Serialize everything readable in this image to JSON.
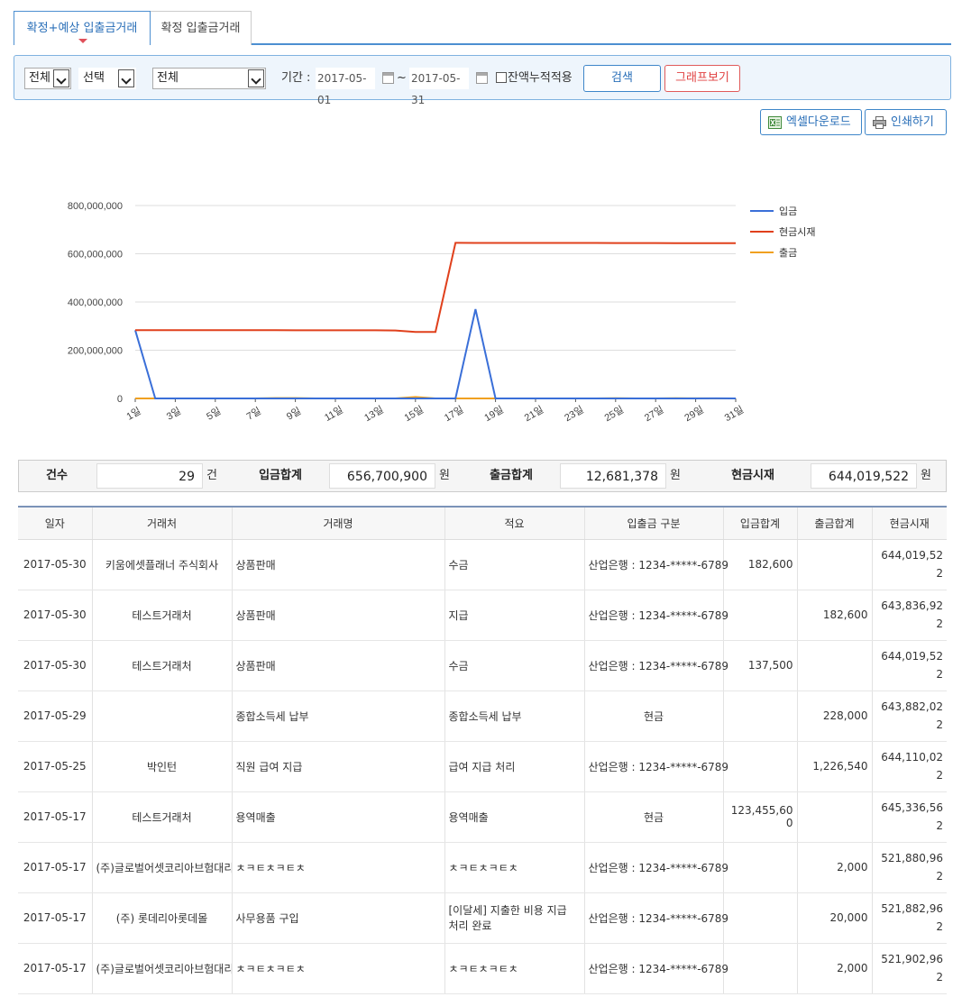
{
  "tabs": [
    {
      "label": "확정+예상 입출금거래",
      "active": true
    },
    {
      "label": "확정 입출금거래",
      "active": false
    }
  ],
  "filters": {
    "select_all": "전체",
    "select_choice": "선택",
    "select_account": "전체",
    "period_label": "기간 :",
    "date_from": "2017-05-01",
    "tilde": "~",
    "date_to": "2017-05-31",
    "checkbox_label": "잔액누적적용",
    "search_label": "검색",
    "graph_label": "그래프보기"
  },
  "tools": {
    "excel_label": "엑셀다운로드",
    "print_label": "인쇄하기"
  },
  "colors": {
    "deposit": "#3a6fd8",
    "balance": "#e0401c",
    "withdraw": "#f0a020"
  },
  "chart_data": {
    "type": "line",
    "x": [
      1,
      2,
      3,
      4,
      5,
      6,
      7,
      8,
      9,
      10,
      11,
      12,
      13,
      14,
      15,
      16,
      17,
      18,
      19,
      20,
      21,
      22,
      23,
      24,
      25,
      26,
      27,
      28,
      29,
      30,
      31
    ],
    "xtick_labels": [
      "1일",
      "3일",
      "5일",
      "7일",
      "9일",
      "11일",
      "13일",
      "15일",
      "17일",
      "19일",
      "21일",
      "23일",
      "25일",
      "27일",
      "29일",
      "31일"
    ],
    "xtick_values": [
      1,
      3,
      5,
      7,
      9,
      11,
      13,
      15,
      17,
      19,
      21,
      23,
      25,
      27,
      29,
      31
    ],
    "ylim": [
      0,
      800000000
    ],
    "yticks": [
      0,
      200000000,
      400000000,
      600000000,
      800000000
    ],
    "ytick_labels": [
      "0",
      "200,000,000",
      "400,000,000",
      "600,000,000",
      "800,000,000"
    ],
    "grid": true,
    "legend_position": "right",
    "series": [
      {
        "name": "입금",
        "color": "#3a6fd8",
        "values": [
          283000000,
          0,
          0,
          0,
          0,
          0,
          0,
          0,
          0,
          0,
          0,
          0,
          0,
          0,
          0,
          0,
          0,
          370000000,
          0,
          0,
          0,
          0,
          0,
          0,
          0,
          0,
          0,
          0,
          0,
          320100,
          0
        ]
      },
      {
        "name": "현금시재",
        "color": "#e0401c",
        "values": [
          283000000,
          283500000,
          283500000,
          283500000,
          283500000,
          283500000,
          283500000,
          283000000,
          282500000,
          282500000,
          282500000,
          282500000,
          282500000,
          282000000,
          276000000,
          276000000,
          645336562,
          645000000,
          645000000,
          645000000,
          645000000,
          645000000,
          645000000,
          645000000,
          644500000,
          644500000,
          644500000,
          644110022,
          643882022,
          644019522,
          644019522
        ]
      },
      {
        "name": "출금",
        "color": "#f0a020",
        "values": [
          0,
          0,
          0,
          0,
          0,
          0,
          0,
          1500000,
          1500000,
          0,
          0,
          0,
          0,
          0,
          6000000,
          0,
          0,
          22000,
          0,
          0,
          0,
          0,
          0,
          0,
          1226540,
          0,
          0,
          1226540,
          228000,
          182600,
          0
        ]
      }
    ]
  },
  "summary": {
    "count_label": "건수",
    "count_value": "29",
    "count_unit": "건",
    "in_label": "입금합계",
    "in_value": "656,700,900",
    "in_unit": "원",
    "out_label": "출금합계",
    "out_value": "12,681,378",
    "out_unit": "원",
    "bal_label": "현금시재",
    "bal_value": "644,019,522",
    "bal_unit": "원"
  },
  "table": {
    "headers": [
      "일자",
      "거래처",
      "거래명",
      "적요",
      "입출금 구분",
      "입금합계",
      "출금합계",
      "현금시재"
    ],
    "rows": [
      {
        "date": "2017-05-30",
        "partner": "키움에셋플래너 주식회사",
        "name": "상품판매",
        "memo": "수금",
        "account": "산업은행 : 1234-*****-6789",
        "in": "182,600",
        "out": "",
        "bal": "644,019,522"
      },
      {
        "date": "2017-05-30",
        "partner": "테스트거래처",
        "name": "상품판매",
        "memo": "지급",
        "account": "산업은행 : 1234-*****-6789",
        "in": "",
        "out": "182,600",
        "bal": "643,836,922"
      },
      {
        "date": "2017-05-30",
        "partner": "테스트거래처",
        "name": "상품판매",
        "memo": "수금",
        "account": "산업은행 : 1234-*****-6789",
        "in": "137,500",
        "out": "",
        "bal": "644,019,522"
      },
      {
        "date": "2017-05-29",
        "partner": "",
        "name": "종합소득세 납부",
        "memo": "종합소득세 납부",
        "account": "현금",
        "in": "",
        "out": "228,000",
        "bal": "643,882,022"
      },
      {
        "date": "2017-05-25",
        "partner": "박인턴",
        "name": "직원 급여 지급",
        "memo": "급여 지급 처리",
        "account": "산업은행 : 1234-*****-6789",
        "in": "",
        "out": "1,226,540",
        "bal": "644,110,022"
      },
      {
        "date": "2017-05-17",
        "partner": "테스트거래처",
        "name": "용역매출",
        "memo": "용역매출",
        "account": "현금",
        "in": "123,455,600",
        "out": "",
        "bal": "645,336,562"
      },
      {
        "date": "2017-05-17",
        "partner": "(주)글로벌어셋코리아브험대리점",
        "name": "ㅊㅋㅌㅊㅋㅌㅊ",
        "memo": "ㅊㅋㅌㅊㅋㅌㅊ",
        "account": "산업은행 : 1234-*****-6789",
        "in": "",
        "out": "2,000",
        "bal": "521,880,962"
      },
      {
        "date": "2017-05-17",
        "partner": "(주) 롯데리아롯데몰",
        "name": "사무용품 구입",
        "memo": "[이달세] 지출한 비용 지급 처리 완료",
        "account": "산업은행 : 1234-*****-6789",
        "in": "",
        "out": "20,000",
        "bal": "521,882,962"
      },
      {
        "date": "2017-05-17",
        "partner": "(주)글로벌어셋코리아브험대리점",
        "name": "ㅊㅋㅌㅊㅋㅌㅊ",
        "memo": "ㅊㅋㅌㅊㅋㅌㅊ",
        "account": "산업은행 : 1234-*****-6789",
        "in": "",
        "out": "2,000",
        "bal": "521,902,962"
      }
    ]
  }
}
